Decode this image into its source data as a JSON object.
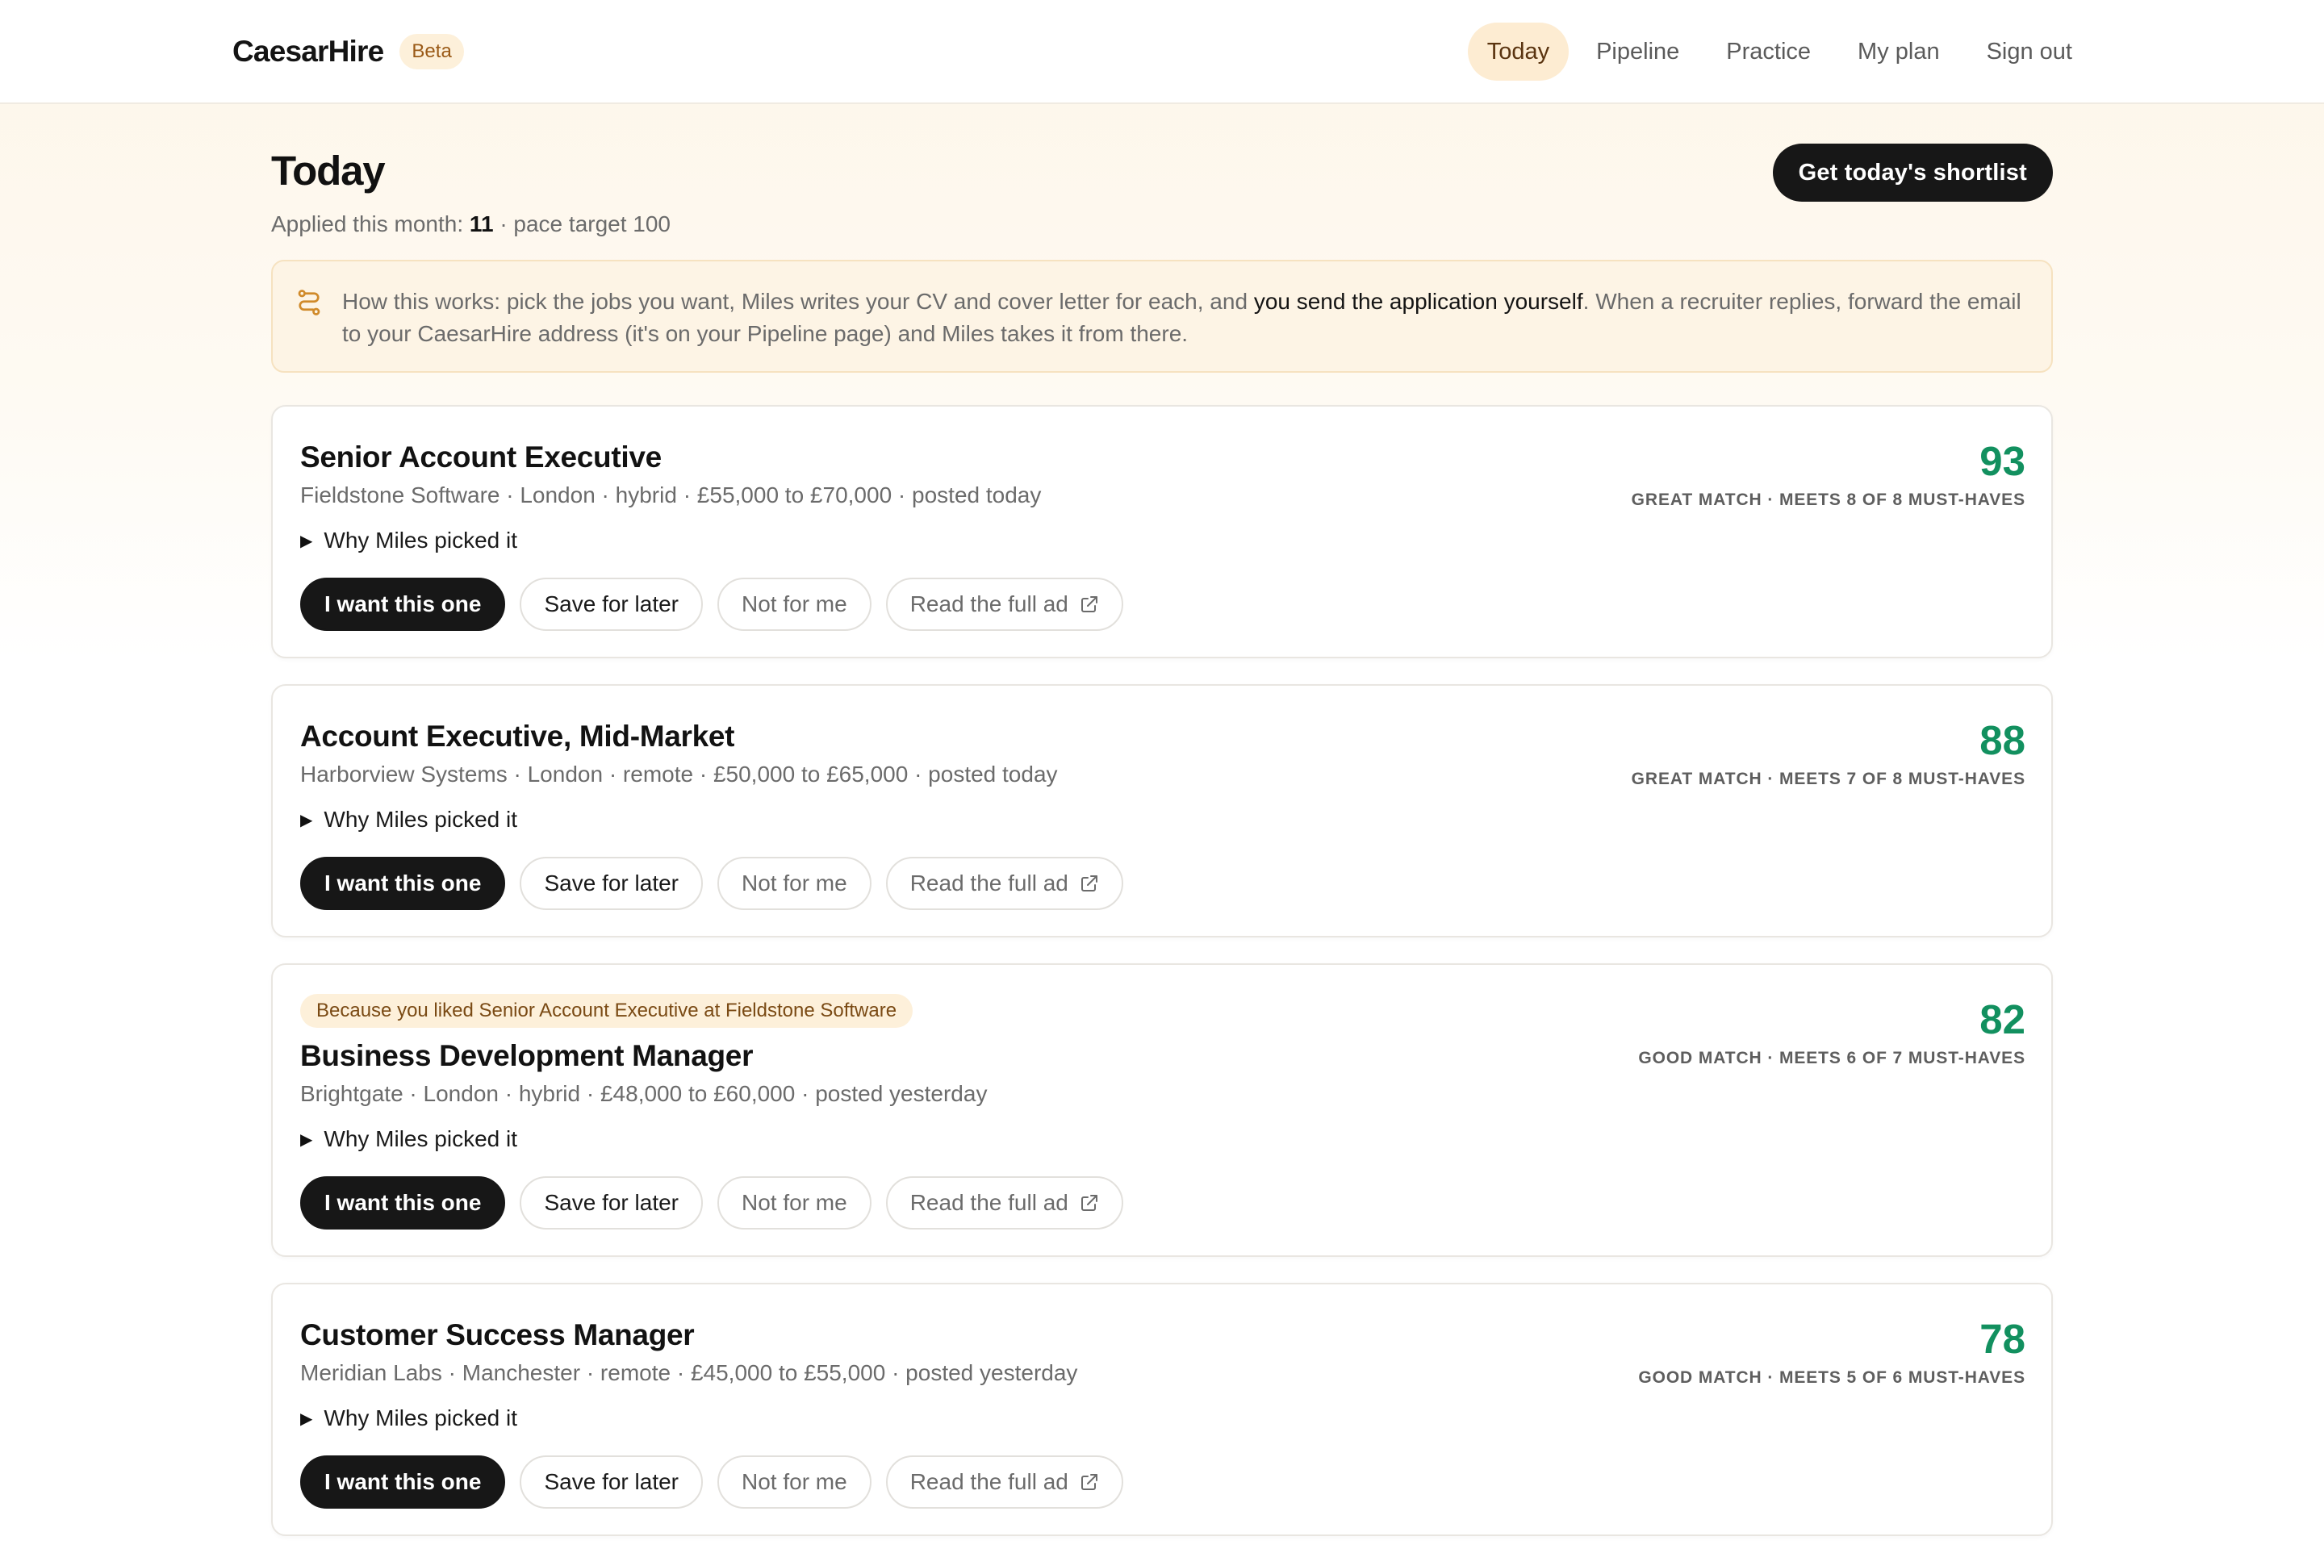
{
  "header": {
    "brand": "CaesarHire",
    "badge": "Beta",
    "nav": [
      {
        "label": "Today",
        "active": true
      },
      {
        "label": "Pipeline",
        "active": false
      },
      {
        "label": "Practice",
        "active": false
      },
      {
        "label": "My plan",
        "active": false
      },
      {
        "label": "Sign out",
        "active": false
      }
    ]
  },
  "page": {
    "title": "Today",
    "applied_label": "Applied this month:",
    "applied_count": "11",
    "pace_text": "· pace target 100",
    "shortlist_button": "Get today's shortlist"
  },
  "info": {
    "icon": "route-icon",
    "text_before": "How this works: pick the jobs you want, Miles writes your CV and cover letter for each, and ",
    "text_strong": "you send the application yourself",
    "text_after": ". When a recruiter replies, forward the email to your CaesarHire address (it's on your Pipeline page) and Miles takes it from there."
  },
  "colors": {
    "accent_dark": "#171717",
    "score_green": "#12905f",
    "warm_tint": "#fdf0da"
  },
  "jobs": [
    {
      "title": "Senior Account Executive",
      "meta": "Fieldstone Software · London · hybrid · £55,000 to £70,000 · posted today",
      "score": "93",
      "match": "GREAT MATCH · MEETS 8 OF 8 MUST-HAVES",
      "why": "Why Miles picked it",
      "actions": {
        "want": "I want this one",
        "save": "Save for later",
        "pass": "Not for me",
        "read": "Read the full ad"
      }
    },
    {
      "title": "Account Executive, Mid-Market",
      "meta": "Harborview Systems · London · remote · £50,000 to £65,000 · posted today",
      "score": "88",
      "match": "GREAT MATCH · MEETS 7 OF 8 MUST-HAVES",
      "why": "Why Miles picked it",
      "actions": {
        "want": "I want this one",
        "save": "Save for later",
        "pass": "Not for me",
        "read": "Read the full ad"
      }
    },
    {
      "reason": "Because you liked Senior Account Executive at Fieldstone Software",
      "title": "Business Development Manager",
      "meta": "Brightgate · London · hybrid · £48,000 to £60,000 · posted yesterday",
      "score": "82",
      "match": "GOOD MATCH · MEETS 6 OF 7 MUST-HAVES",
      "why": "Why Miles picked it",
      "actions": {
        "want": "I want this one",
        "save": "Save for later",
        "pass": "Not for me",
        "read": "Read the full ad"
      }
    },
    {
      "title": "Customer Success Manager",
      "meta": "Meridian Labs · Manchester · remote · £45,000 to £55,000 · posted yesterday",
      "score": "78",
      "match": "GOOD MATCH · MEETS 5 OF 6 MUST-HAVES",
      "why": "Why Miles picked it",
      "actions": {
        "want": "I want this one",
        "save": "Save for later",
        "pass": "Not for me",
        "read": "Read the full ad"
      }
    }
  ]
}
